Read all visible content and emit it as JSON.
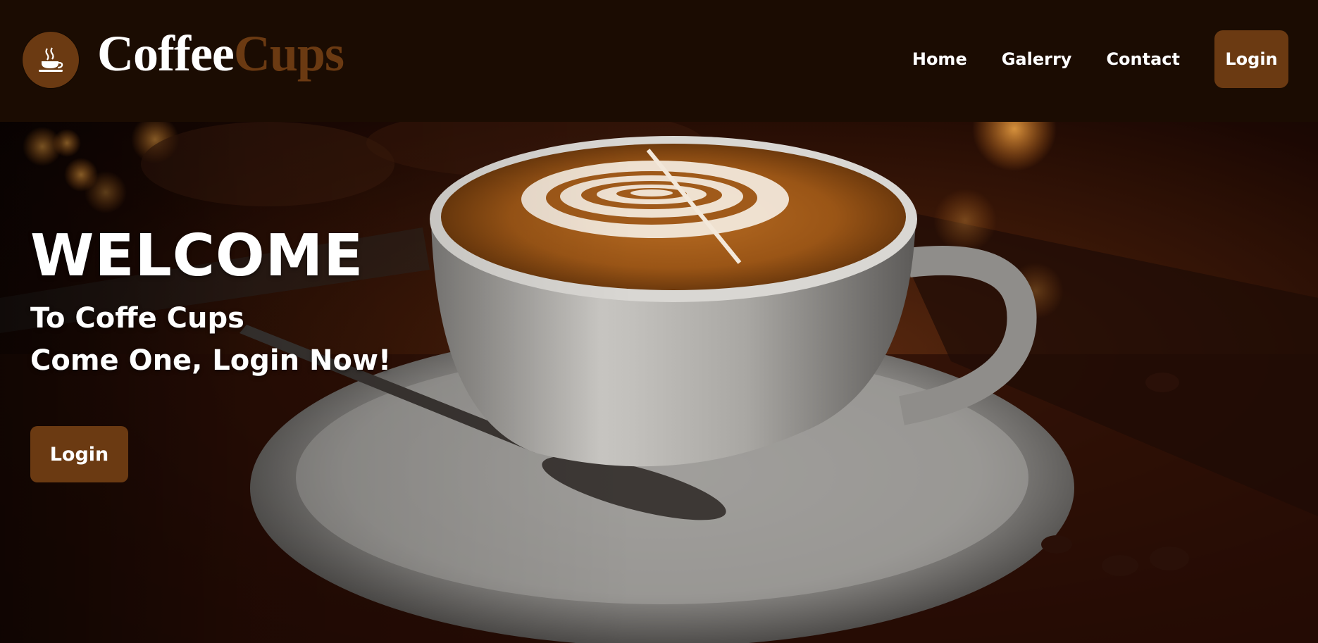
{
  "brand": {
    "part1": "Coffee",
    "part2": "Cups",
    "logo_icon": "coffee-cup-icon"
  },
  "nav": {
    "items": [
      {
        "label": "Home"
      },
      {
        "label": "Galerry"
      },
      {
        "label": "Contact"
      }
    ],
    "login_label": "Login"
  },
  "hero": {
    "title": "WELCOME",
    "line1": "To Coffe Cups",
    "line2": "Come One, Login Now!",
    "button_label": "Login",
    "image": "latte-art-cup-on-saucer"
  },
  "colors": {
    "header_bg": "#1b0c02",
    "accent": "#6b3a12",
    "text": "#ffffff"
  }
}
